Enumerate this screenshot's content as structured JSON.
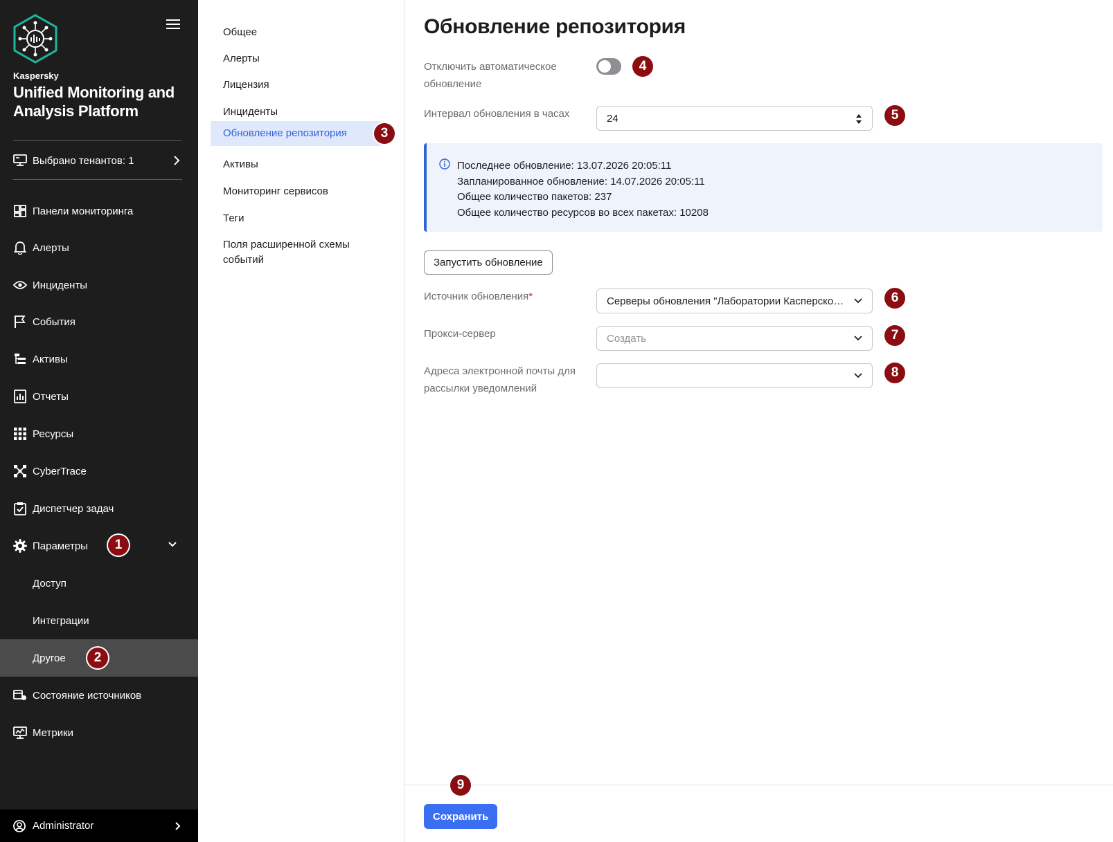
{
  "brand": {
    "company": "Kaspersky",
    "product": "Unified Monitoring and Analysis Platform"
  },
  "tenant": {
    "label": "Выбрано тенантов: 1"
  },
  "nav": {
    "items": [
      {
        "label": "Панели мониторинга",
        "icon": "dashboard-icon"
      },
      {
        "label": "Алерты",
        "icon": "bell-icon"
      },
      {
        "label": "Инциденты",
        "icon": "eye-icon"
      },
      {
        "label": "События",
        "icon": "flag-icon"
      },
      {
        "label": "Активы",
        "icon": "asset-tree-icon"
      },
      {
        "label": "Отчеты",
        "icon": "report-icon"
      },
      {
        "label": "Ресурсы",
        "icon": "grid-icon"
      },
      {
        "label": "CyberTrace",
        "icon": "cybertrace-icon"
      },
      {
        "label": "Диспетчер задач",
        "icon": "clipboard-check-icon"
      },
      {
        "label": "Параметры",
        "icon": "gear-icon"
      }
    ],
    "params_sub": [
      "Доступ",
      "Интеграции",
      "Другое"
    ],
    "bottom_items": [
      {
        "label": "Состояние источников",
        "icon": "source-status-icon"
      },
      {
        "label": "Метрики",
        "icon": "monitor-metrics-icon"
      }
    ],
    "user": "Administrator"
  },
  "submenu": {
    "items": [
      "Общее",
      "Алерты",
      "Лицензия",
      "Инциденты",
      "Обновление репозитория",
      "Активы",
      "Мониторинг сервисов",
      "Теги",
      "Поля расширенной схемы событий"
    ],
    "active_index": 4
  },
  "main": {
    "title": "Обновление репозитория",
    "disable_auto_update": {
      "label": "Отключить автоматическое обновление",
      "enabled": false
    },
    "interval": {
      "label": "Интервал обновления в часах",
      "value": "24"
    },
    "info": {
      "lines": [
        "Последнее обновление: 13.07.2026 20:05:11",
        "Запланированное обновление: 14.07.2026 20:05:11",
        "Общее количество пакетов: 237",
        "Общее количество ресурсов во всех пакетах: 10208"
      ]
    },
    "run_button": "Запустить обновление",
    "source": {
      "label": "Источник обновления",
      "required_mark": "*",
      "value": "Серверы обновления \"Лаборатории Касперского\""
    },
    "proxy": {
      "label": "Прокси-сервер",
      "placeholder": "Создать"
    },
    "emails": {
      "label": "Адреса электронной почты для рассылки уведомлений",
      "value": ""
    },
    "save_button": "Сохранить"
  },
  "callouts": [
    "1",
    "2",
    "3",
    "4",
    "5",
    "6",
    "7",
    "8",
    "9"
  ],
  "colors": {
    "sidebar_bg": "#1d1d1d",
    "active_sub_bg": "#4b4b4b",
    "accent": "#3b6ff3",
    "callout": "#8b0d12",
    "info_bg": "#eef3fc"
  }
}
